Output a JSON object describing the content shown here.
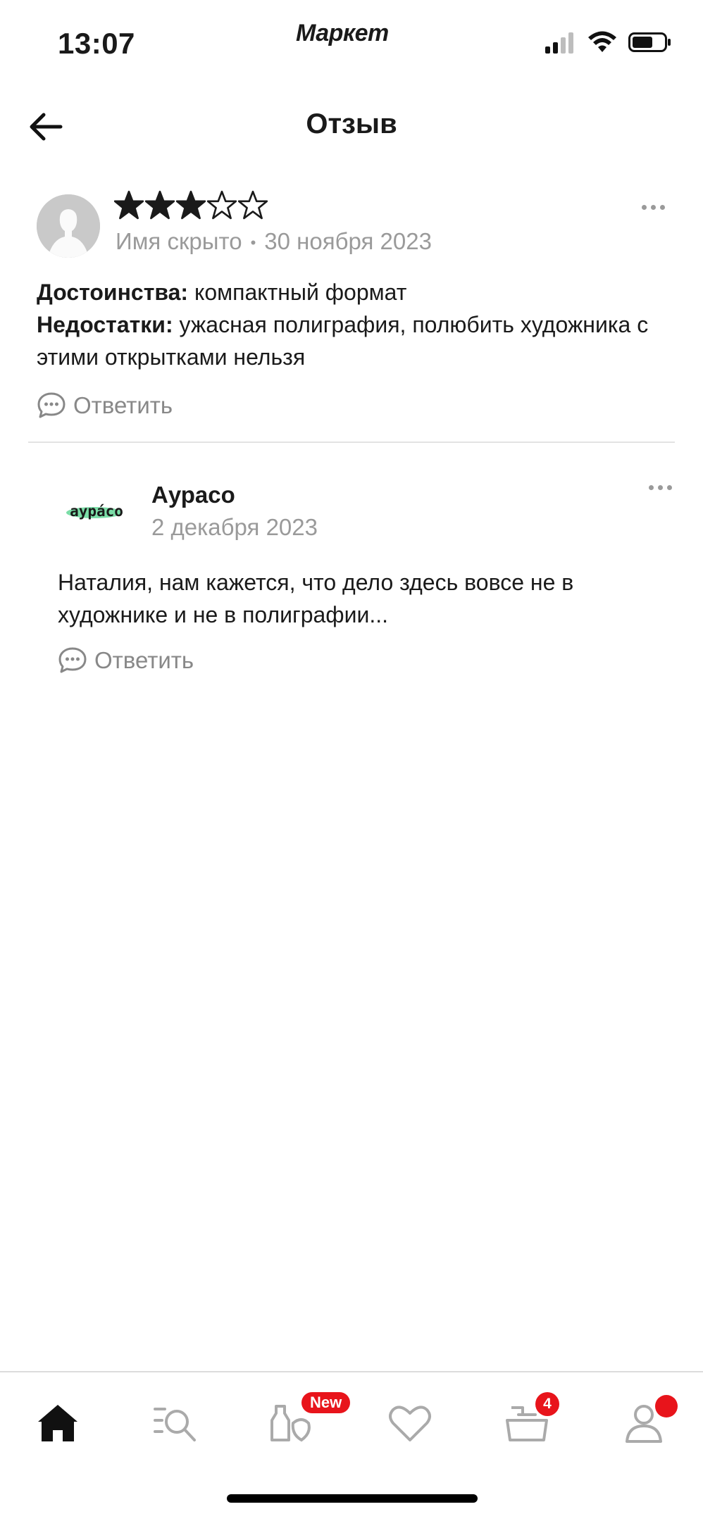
{
  "status_bar": {
    "time": "13:07",
    "brand": "Маркет"
  },
  "header": {
    "title": "Отзыв",
    "back_icon": "arrow-left-icon"
  },
  "review": {
    "rating": 3,
    "rating_max": 5,
    "author": "Имя скрыто",
    "separator": "•",
    "date": "30 ноября 2023",
    "pros_label": "Достоинства:",
    "pros_text": " компактный формат",
    "cons_label": "Недостатки:",
    "cons_text": " ужасная полиграфия, полюбить художника с этими открытками нельзя",
    "reply_label": "Ответить"
  },
  "shop_reply": {
    "logo_text": "аурáсо",
    "name": "Аурасо",
    "date": "2 декабря 2023",
    "text": "Наталия, нам кажется, что дело здесь вовсе не в художнике и не в полиграфии...",
    "reply_label": "Ответить"
  },
  "bottom_nav": {
    "items": [
      "home-icon",
      "catalog-search-icon",
      "products-icon",
      "favorites-icon",
      "cart-icon",
      "profile-icon"
    ],
    "new_badge": "New",
    "cart_count": "4"
  },
  "colors": {
    "accent": "#e8141b",
    "text_primary": "#1a1a1a",
    "text_secondary": "#9a9a9a"
  }
}
